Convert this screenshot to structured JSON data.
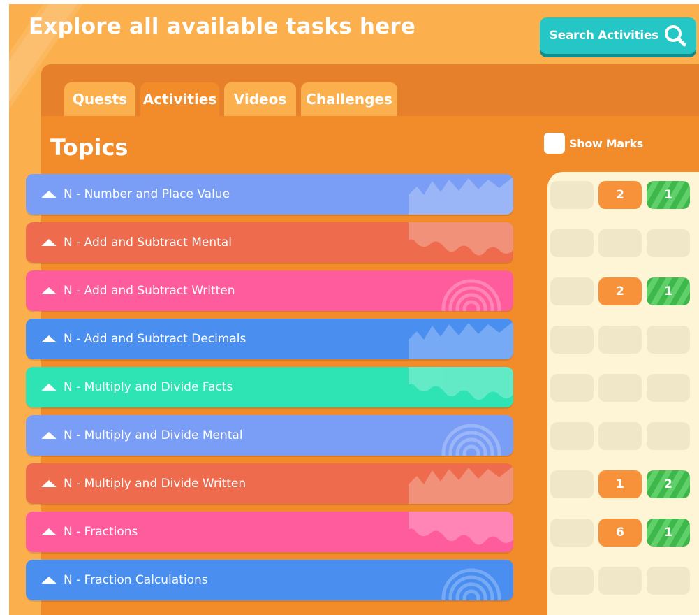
{
  "page": {
    "title": "Explore all available tasks here",
    "search_label": "Search Activities"
  },
  "tabs": [
    "Quests",
    "Activities",
    "Videos",
    "Challenges"
  ],
  "active_tab": "Activities",
  "section_title": "Topics",
  "show_marks_label": "Show Marks",
  "topics": [
    {
      "label": "N - Number and Place Value",
      "color": "#7a9ef5"
    },
    {
      "label": "N - Add and Subtract Mental",
      "color": "#ee6c4d"
    },
    {
      "label": "N - Add and Subtract Written",
      "color": "#ff5c9e"
    },
    {
      "label": "N - Add and Subtract Decimals",
      "color": "#4a8ef0"
    },
    {
      "label": "N - Multiply and Divide Facts",
      "color": "#2ee3b4"
    },
    {
      "label": "N - Multiply and Divide Mental",
      "color": "#7a9ef5"
    },
    {
      "label": "N - Multiply and Divide Written",
      "color": "#ee6c4d"
    },
    {
      "label": "N - Fractions",
      "color": "#ff5c9e"
    },
    {
      "label": "N - Fraction Calculations",
      "color": "#4a8ef0"
    }
  ],
  "marks": [
    [
      "",
      "2",
      "1"
    ],
    [
      "",
      "",
      ""
    ],
    [
      "",
      "2",
      "1"
    ],
    [
      "",
      "",
      ""
    ],
    [
      "",
      "",
      ""
    ],
    [
      "",
      "",
      ""
    ],
    [
      "",
      "1",
      "2"
    ],
    [
      "",
      "6",
      "1"
    ],
    [
      "",
      "",
      ""
    ]
  ],
  "colors": {
    "background": "#fbb04d",
    "panel": "#f28c2a",
    "search": "#25c6c6",
    "mark_orange": "#f7923a",
    "mark_green": "#3eb84a"
  }
}
